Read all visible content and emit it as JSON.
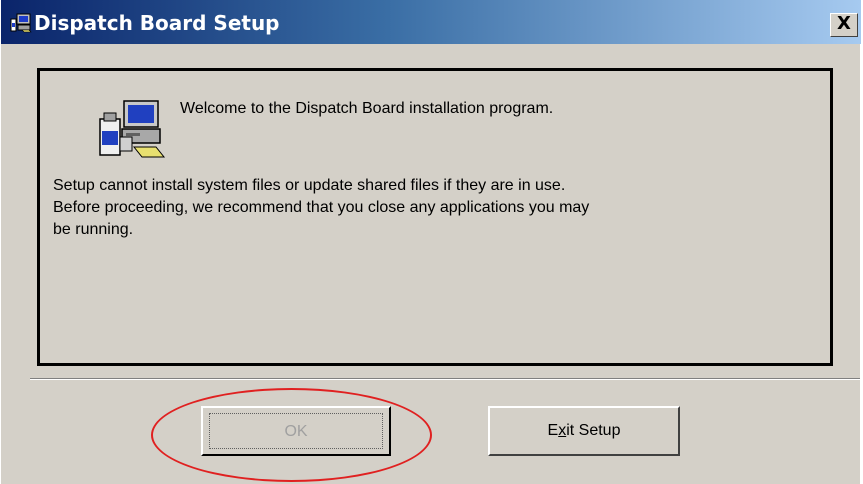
{
  "window": {
    "title": "Dispatch Board Setup",
    "close_label": "X"
  },
  "panel": {
    "welcome": "Welcome to the Dispatch Board installation program.",
    "lines": [
      "Setup cannot install system files or update shared files if they are in use.",
      "Before proceeding, we recommend that you close any applications you may",
      "be running."
    ]
  },
  "buttons": {
    "ok_label": "OK",
    "exit_prefix": "E",
    "exit_mnemonic": "x",
    "exit_suffix": "it Setup"
  },
  "colors": {
    "titlebar_start": "#0a246a",
    "titlebar_end": "#a6caf0",
    "dialog_face": "#d4d0c8",
    "highlight": "#e02020"
  },
  "icons": {
    "title": "setup-computer-icon",
    "panel": "computer-install-icon"
  }
}
